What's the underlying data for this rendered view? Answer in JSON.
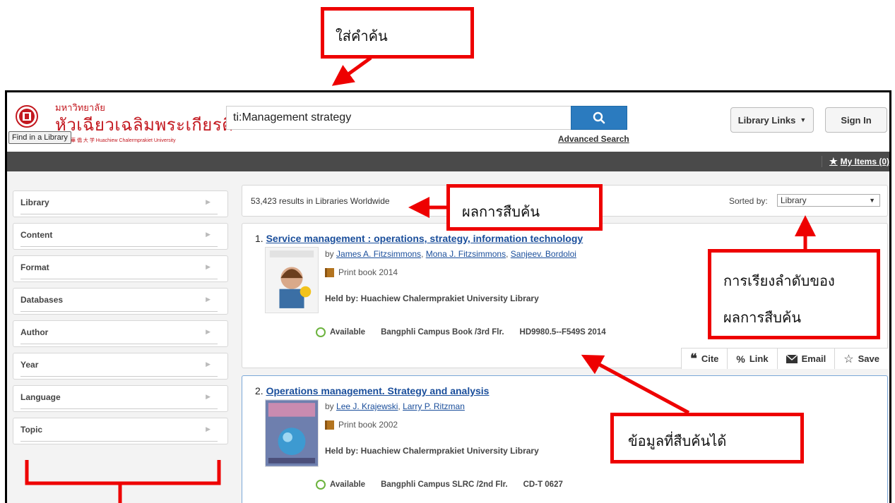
{
  "annotations": {
    "search_hint": "ใส่คำค้น",
    "results_hint": "ผลการสืบค้น",
    "sort_hint_line1": "การเรียงลำดับของ",
    "sort_hint_line2": "ผลการสืบค้น",
    "data_hint": "ข้อมูลที่สืบค้นได้",
    "color": "#e00000"
  },
  "header": {
    "logo_thai_small": "มหาวิทยาลัย",
    "logo_thai_big": "หัวเฉียวเฉลิมพระเกียรติ",
    "logo_english": "華 僑 大 学   Huachiew Chalermprakiet University",
    "find_in_library": "Find in a Library",
    "search_value": "ti:Management strategy",
    "advanced_search": "Advanced Search",
    "library_links": "Library Links",
    "sign_in": "Sign In",
    "accent_color": "#2b7bbf",
    "brand_color": "#c3181f"
  },
  "toolbar": {
    "my_items": "My Items (0)"
  },
  "facets": [
    {
      "label": "Library"
    },
    {
      "label": "Content"
    },
    {
      "label": "Format"
    },
    {
      "label": "Databases"
    },
    {
      "label": "Author"
    },
    {
      "label": "Year"
    },
    {
      "label": "Language"
    },
    {
      "label": "Topic"
    }
  ],
  "results": {
    "count_text": "53,423 results in Libraries Worldwide",
    "sorted_by_label": "Sorted by:",
    "sorted_by_value": "Library",
    "items": [
      {
        "number": "1.",
        "title": "Service management : operations, strategy, information technology",
        "by": "by",
        "authors": [
          "James A. Fitzsimmons",
          "Mona J. Fitzsimmons",
          "Sanjeev. Bordoloi"
        ],
        "format": "Print book 2014",
        "held_by": "Held by: Huachiew Chalermprakiet University Library",
        "availability": "Available",
        "location": "Bangphli Campus Book /3rd Flr.",
        "call_number": "HD9980.5--F549S 2014",
        "actions": [
          "Cite",
          "Link",
          "Email",
          "Save"
        ]
      },
      {
        "number": "2.",
        "title": "Operations management. Strategy and analysis",
        "by": "by",
        "authors": [
          "Lee J. Krajewski",
          "Larry P. Ritzman"
        ],
        "format": "Print book 2002",
        "held_by": "Held by: Huachiew Chalermprakiet University Library",
        "availability": "Available",
        "location": "Bangphli Campus SLRC /2nd Flr.",
        "call_number": "CD-T 0627"
      }
    ]
  }
}
